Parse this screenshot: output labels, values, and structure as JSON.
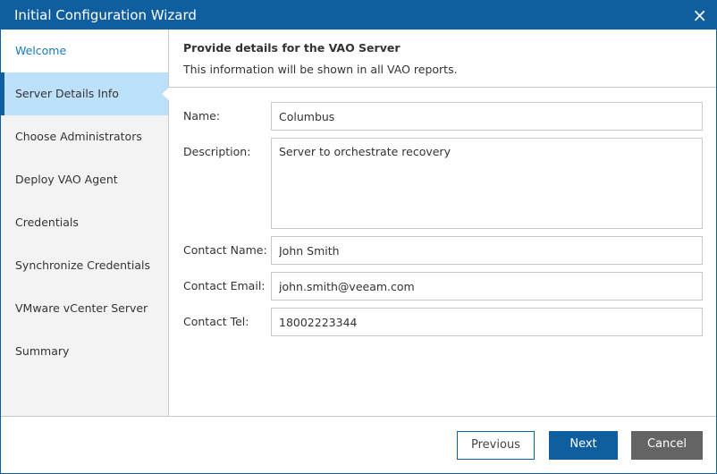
{
  "window": {
    "title": "Initial Configuration Wizard",
    "close_icon": "×"
  },
  "sidebar": {
    "items": [
      {
        "label": "Welcome"
      },
      {
        "label": "Server Details Info"
      },
      {
        "label": "Choose Administrators"
      },
      {
        "label": "Deploy VAO Agent"
      },
      {
        "label": "Credentials"
      },
      {
        "label": "Synchronize Credentials"
      },
      {
        "label": "VMware vCenter Server"
      },
      {
        "label": "Summary"
      }
    ]
  },
  "header": {
    "title": "Provide details for the VAO Server",
    "subtitle": "This information will be shown in all VAO reports."
  },
  "form": {
    "name": {
      "label": "Name:",
      "value": "Columbus"
    },
    "description": {
      "label": "Description:",
      "value": "Server to orchestrate recovery"
    },
    "contact_name": {
      "label": "Contact Name:",
      "value": "John Smith"
    },
    "contact_email": {
      "label": "Contact Email:",
      "value": "john.smith@veeam.com"
    },
    "contact_tel": {
      "label": "Contact Tel:",
      "value": "18002223344"
    }
  },
  "buttons": {
    "previous": "Previous",
    "next": "Next",
    "cancel": "Cancel"
  }
}
